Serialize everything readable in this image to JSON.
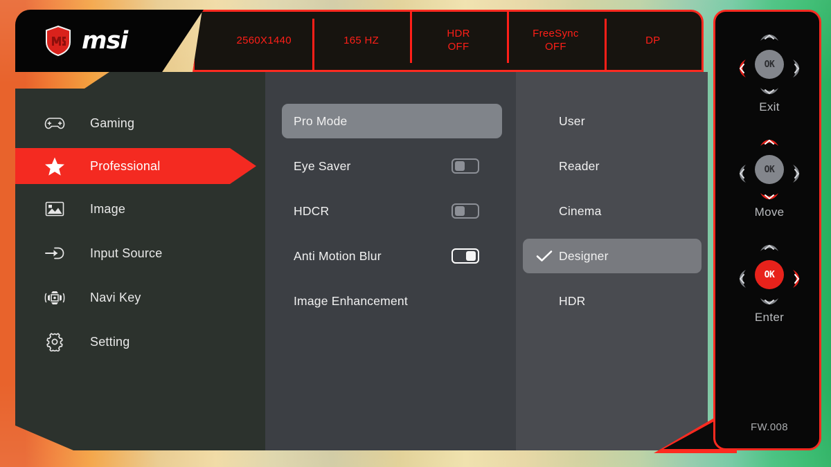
{
  "header": {
    "brand": "msi",
    "brand_icon": "msi-dragon-shield-logo",
    "info": [
      {
        "line1": "2560X1440",
        "line2": ""
      },
      {
        "line1": "165 HZ",
        "line2": ""
      },
      {
        "line1": "HDR",
        "line2": "OFF"
      },
      {
        "line1": "FreeSync",
        "line2": "OFF"
      },
      {
        "line1": "DP",
        "line2": ""
      }
    ],
    "info_color": "#ff1f18",
    "border_color": "#ff2a20"
  },
  "sidebar": {
    "items": [
      {
        "label": "Gaming",
        "icon": "gamepad-icon",
        "active": false
      },
      {
        "label": "Professional",
        "icon": "star-icon",
        "active": true
      },
      {
        "label": "Image",
        "icon": "picture-icon",
        "active": false
      },
      {
        "label": "Input Source",
        "icon": "input-arrow-icon",
        "active": false
      },
      {
        "label": "Navi Key",
        "icon": "navi-key-icon",
        "active": false
      },
      {
        "label": "Setting",
        "icon": "gear-icon",
        "active": false
      }
    ],
    "active_color": "#f42a21"
  },
  "options": [
    {
      "label": "Pro Mode",
      "selected": true,
      "toggle": null
    },
    {
      "label": "Eye Saver",
      "selected": false,
      "toggle": "off"
    },
    {
      "label": "HDCR",
      "selected": false,
      "toggle": "off"
    },
    {
      "label": "Anti Motion Blur",
      "selected": false,
      "toggle": "on"
    },
    {
      "label": "Image Enhancement",
      "selected": false,
      "toggle": null
    }
  ],
  "values": [
    {
      "label": "User",
      "checked": false,
      "selected": false
    },
    {
      "label": "Reader",
      "checked": false,
      "selected": false
    },
    {
      "label": "Cinema",
      "checked": false,
      "selected": false
    },
    {
      "label": "Designer",
      "checked": true,
      "selected": true
    },
    {
      "label": "HDR",
      "checked": false,
      "selected": false
    }
  ],
  "navkey": {
    "pads": [
      {
        "caption": "Exit",
        "ok_label": "OK",
        "hot": "left"
      },
      {
        "caption": "Move",
        "ok_label": "OK",
        "hot": "updown"
      },
      {
        "caption": "Enter",
        "ok_label": "OK",
        "hot": "right-center"
      }
    ],
    "firmware": "FW.008"
  }
}
